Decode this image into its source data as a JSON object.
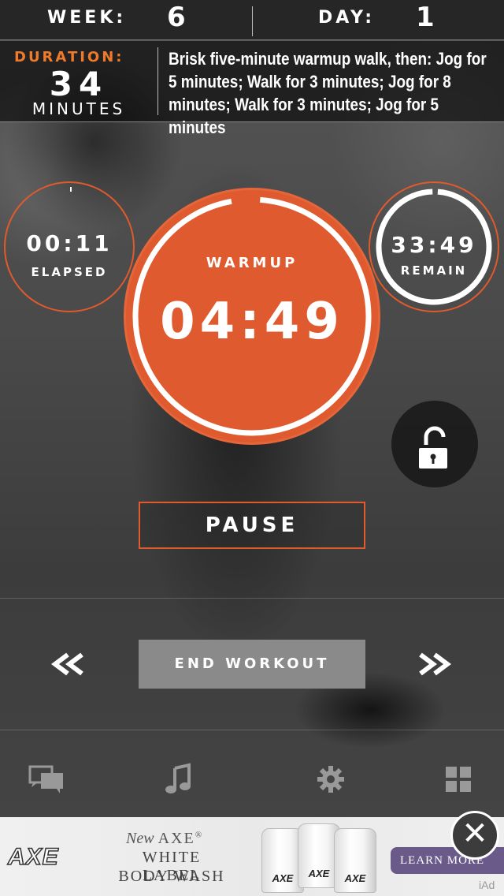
{
  "header": {
    "week_label": "WEEK:",
    "week_value": "6",
    "day_label": "DAY:",
    "day_value": "1"
  },
  "duration": {
    "label": "DURATION:",
    "value": "34",
    "unit": "MINUTES"
  },
  "description": "Brisk five-minute warmup walk, then: Jog for 5 minutes; Walk for 3 minutes; Jog for 8 minutes; Walk for 3 minutes; Jog for 5 minutes",
  "elapsed": {
    "time": "00:11",
    "label": "ELAPSED"
  },
  "remain": {
    "time": "33:49",
    "label": "REMAIN"
  },
  "current": {
    "phase": "WARMUP",
    "time": "04:49"
  },
  "controls": {
    "pause_label": "PAUSE",
    "end_label": "END WORKOUT"
  },
  "tabs": [
    "chat-icon",
    "music-icon",
    "gear-icon",
    "grid-icon"
  ],
  "ad": {
    "brand": "AXE",
    "new_text": "New",
    "product_name": "AXE",
    "trademark": "®",
    "line1": "WHITE LABEL",
    "line2": "BODY WASH",
    "bottle_label": "AXE",
    "cta": "LEARN MORE",
    "iad": "iAd"
  },
  "colors": {
    "accent": "#df5a2e",
    "orange_text": "#f07a2a"
  }
}
